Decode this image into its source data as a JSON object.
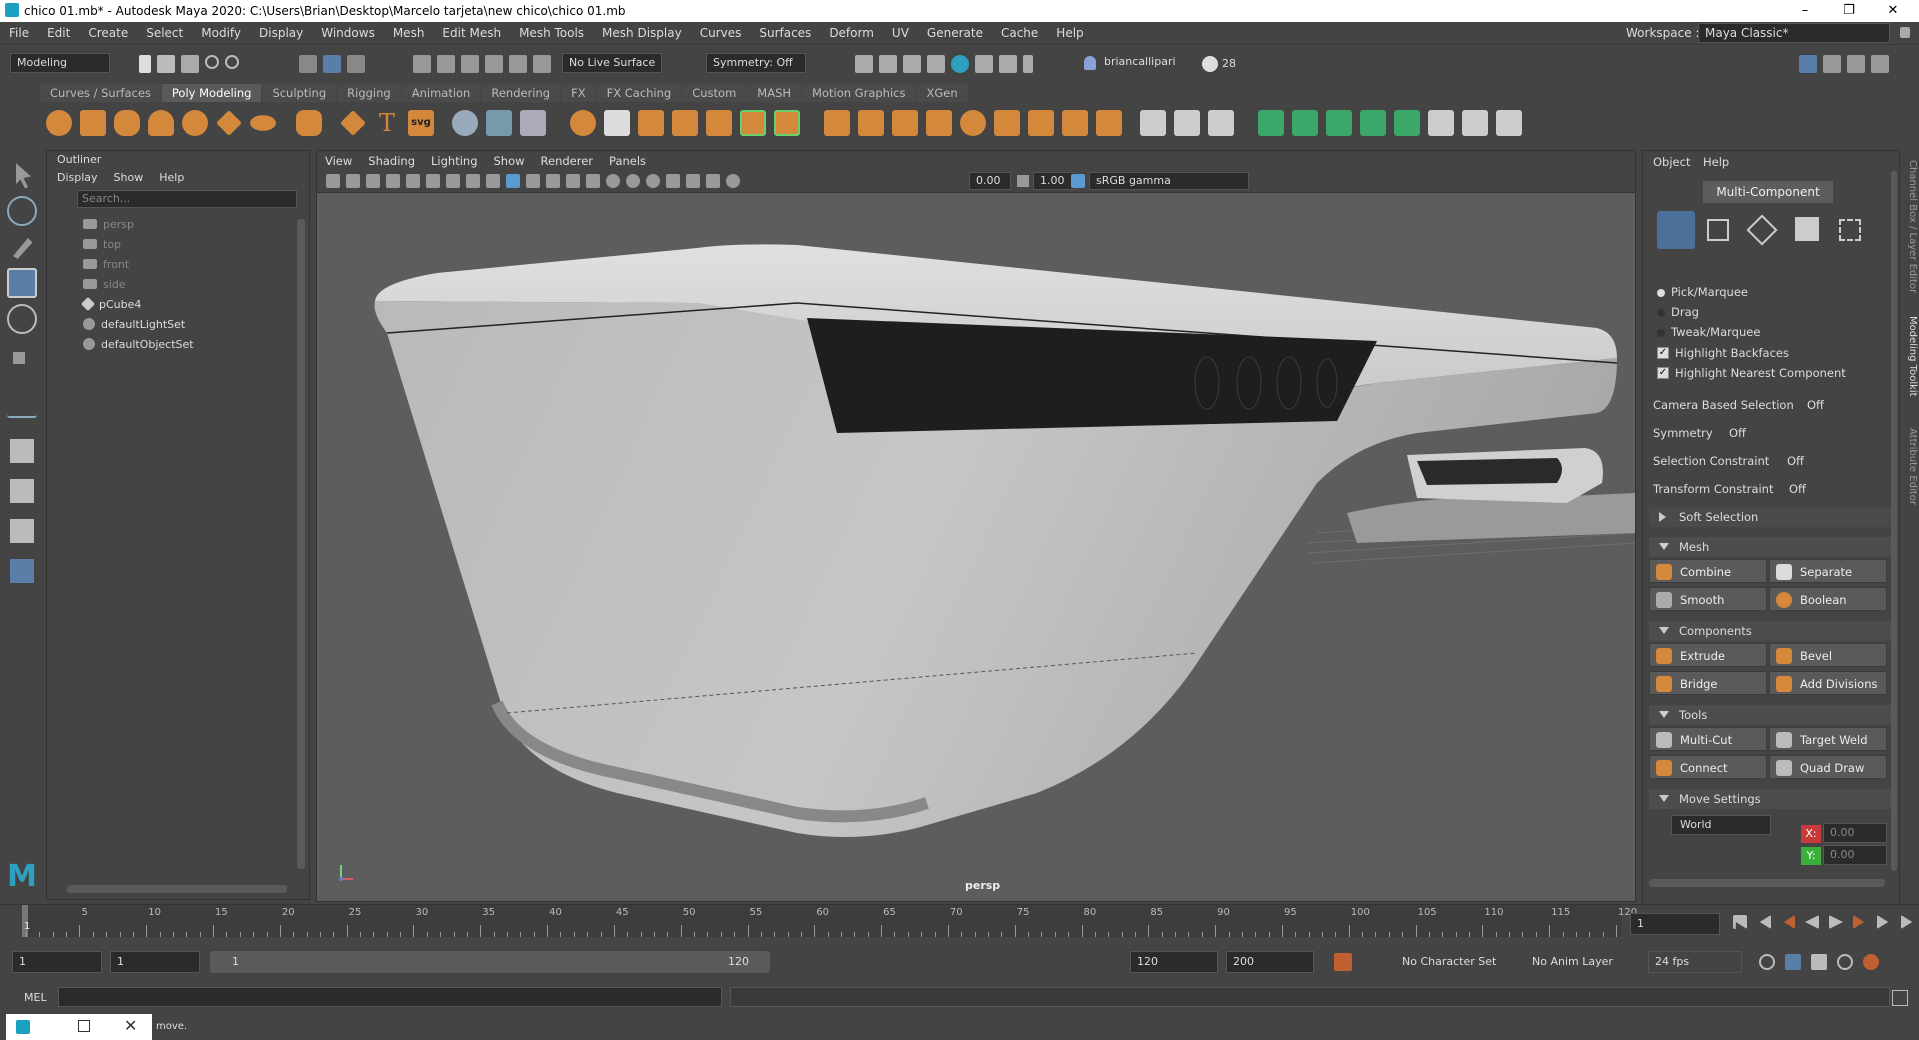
{
  "window": {
    "title": "chico 01.mb* - Autodesk Maya 2020: C:\\Users\\Brian\\Desktop\\Marcelo tarjeta\\new chico\\chico 01.mb"
  },
  "menu": [
    "File",
    "Edit",
    "Create",
    "Select",
    "Modify",
    "Display",
    "Windows",
    "Mesh",
    "Edit Mesh",
    "Mesh Tools",
    "Mesh Display",
    "Curves",
    "Surfaces",
    "Deform",
    "UV",
    "Generate",
    "Cache",
    "Help"
  ],
  "workspace": {
    "label": "Workspace :",
    "value": "Maya Classic*"
  },
  "statusline": {
    "mode": "Modeling",
    "live_surface": "No Live Surface",
    "symmetry": "Symmetry: Off",
    "user": "briancallipari",
    "count": "28"
  },
  "shelf_tabs": [
    "Curves / Surfaces",
    "Poly Modeling",
    "Sculpting",
    "Rigging",
    "Animation",
    "Rendering",
    "FX",
    "FX Caching",
    "Custom",
    "MASH",
    "Motion Graphics",
    "XGen"
  ],
  "shelf_svg": "svg",
  "outliner": {
    "title": "Outliner",
    "menu": [
      "Display",
      "Show",
      "Help"
    ],
    "search_placeholder": "Search...",
    "items": [
      "persp",
      "top",
      "front",
      "side",
      "pCube4",
      "defaultLightSet",
      "defaultObjectSet"
    ]
  },
  "viewport": {
    "menu": [
      "View",
      "Shading",
      "Lighting",
      "Show",
      "Renderer",
      "Panels"
    ],
    "field1": "0.00",
    "field2": "1.00",
    "colorspace": "sRGB gamma",
    "camera": "persp"
  },
  "right_panel": {
    "menu": [
      "Object",
      "Help"
    ],
    "title": "Multi-Component",
    "pick_modes": [
      "Pick/Marquee",
      "Drag",
      "Tweak/Marquee"
    ],
    "checks": [
      "Highlight Backfaces",
      "Highlight Nearest Component"
    ],
    "options": [
      {
        "label": "Camera Based Selection",
        "value": "Off"
      },
      {
        "label": "Symmetry",
        "value": "Off"
      },
      {
        "label": "Selection Constraint",
        "value": "Off"
      },
      {
        "label": "Transform Constraint",
        "value": "Off"
      }
    ],
    "soft_selection": "Soft Selection",
    "sections": {
      "mesh": "Mesh",
      "components": "Components",
      "tools": "Tools",
      "move": "Move Settings"
    },
    "mesh_buttons": [
      "Combine",
      "Separate",
      "Smooth",
      "Boolean"
    ],
    "component_buttons": [
      "Extrude",
      "Bevel",
      "Bridge",
      "Add Divisions"
    ],
    "tool_buttons": [
      "Multi-Cut",
      "Target Weld",
      "Connect",
      "Quad Draw"
    ],
    "move_space": "World",
    "xyz": [
      {
        "axis": "X:",
        "value": "0.00"
      },
      {
        "axis": "Y:",
        "value": "0.00"
      }
    ]
  },
  "side_tabs": [
    "Channel Box / Layer Editor",
    "Modeling Toolkit",
    "Attribute Editor"
  ],
  "timeline": {
    "ticks": [
      "1",
      "5",
      "10",
      "15",
      "20",
      "25",
      "30",
      "35",
      "40",
      "45",
      "50",
      "55",
      "60",
      "65",
      "70",
      "75",
      "80",
      "85",
      "90",
      "95",
      "100",
      "105",
      "110",
      "115",
      "120"
    ],
    "current": "1"
  },
  "range": {
    "start": "1",
    "start2": "1",
    "slider_start": "1",
    "slider_end": "120",
    "end": "120",
    "end2": "200",
    "character": "No Character Set",
    "anim_layer": "No Anim Layer",
    "fps": "24 fps"
  },
  "cmd": {
    "label": "MEL"
  },
  "help": {
    "text": "move."
  }
}
